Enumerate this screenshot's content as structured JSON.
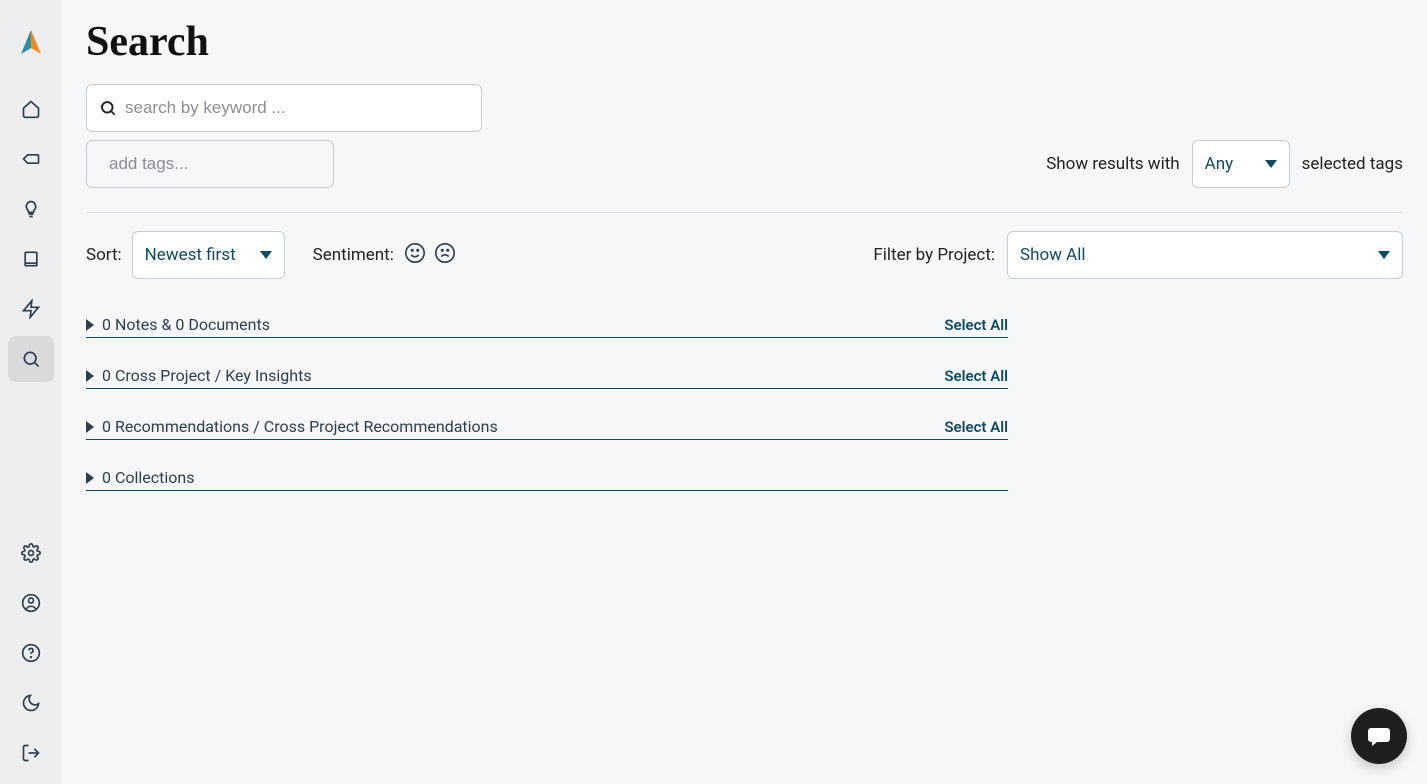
{
  "page": {
    "title": "Search"
  },
  "search": {
    "keyword_placeholder": "search by keyword ...",
    "tags_placeholder": "add tags..."
  },
  "results_filter": {
    "prefix": "Show results with",
    "mode": "Any",
    "suffix": "selected tags"
  },
  "sort": {
    "label": "Sort:",
    "value": "Newest first"
  },
  "sentiment": {
    "label": "Sentiment:"
  },
  "project_filter": {
    "label": "Filter by Project:",
    "value": "Show All"
  },
  "sections": [
    {
      "title": "0 Notes & 0 Documents",
      "select_all": "Select All"
    },
    {
      "title": "0 Cross Project / Key Insights",
      "select_all": "Select All"
    },
    {
      "title": "0 Recommendations / Cross Project Recommendations",
      "select_all": "Select All"
    },
    {
      "title": "0 Collections",
      "select_all": ""
    }
  ],
  "sidebar": {
    "items": [
      {
        "name": "home"
      },
      {
        "name": "tag"
      },
      {
        "name": "insight"
      },
      {
        "name": "book"
      },
      {
        "name": "bolt"
      },
      {
        "name": "search",
        "active": true
      }
    ],
    "bottom": [
      {
        "name": "settings"
      },
      {
        "name": "profile"
      },
      {
        "name": "help"
      },
      {
        "name": "theme"
      },
      {
        "name": "logout"
      }
    ]
  }
}
